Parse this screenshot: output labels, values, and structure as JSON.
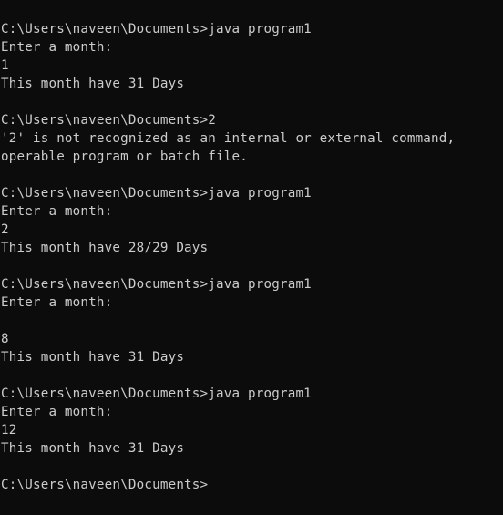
{
  "terminal": {
    "lines": [
      "C:\\Users\\naveen\\Documents>java program1",
      "Enter a month:",
      "1",
      "This month have 31 Days",
      "",
      "C:\\Users\\naveen\\Documents>2",
      "'2' is not recognized as an internal or external command,",
      "operable program or batch file.",
      "",
      "C:\\Users\\naveen\\Documents>java program1",
      "Enter a month:",
      "2",
      "This month have 28/29 Days",
      "",
      "C:\\Users\\naveen\\Documents>java program1",
      "Enter a month:",
      "",
      "8",
      "This month have 31 Days",
      "",
      "C:\\Users\\naveen\\Documents>java program1",
      "Enter a month:",
      "12",
      "This month have 31 Days",
      "",
      "C:\\Users\\naveen\\Documents>"
    ]
  }
}
